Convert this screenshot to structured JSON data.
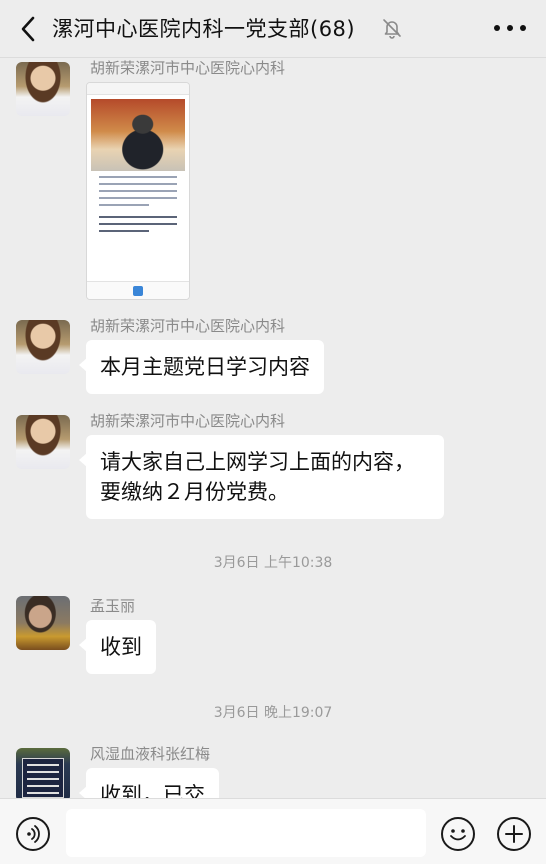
{
  "header": {
    "title": "漯河中心医院内科一党支部(68)"
  },
  "messages": [
    {
      "sender": "胡新荣漯河市中心医院心内科",
      "type": "image"
    },
    {
      "sender": "胡新荣漯河市中心医院心内科",
      "text": "本月主题党日学习内容"
    },
    {
      "sender": "胡新荣漯河市中心医院心内科",
      "lines": [
        "请大家自己上网学习上面的内容，",
        "要缴纳２月份党费。"
      ]
    },
    {
      "sender": "孟玉丽",
      "text": "收到"
    },
    {
      "sender": "风湿血液科张红梅",
      "text": "收到，已交"
    }
  ],
  "timestamps": [
    "3月6日 上午10:38",
    "3月6日 晚上19:07"
  ],
  "input": {
    "value": ""
  },
  "icons": {
    "back": "chevron-left-icon",
    "mute": "bell-off-icon",
    "more": "more-dots-icon",
    "voice": "voice-icon",
    "emoji": "emoji-icon",
    "plus": "plus-icon"
  }
}
